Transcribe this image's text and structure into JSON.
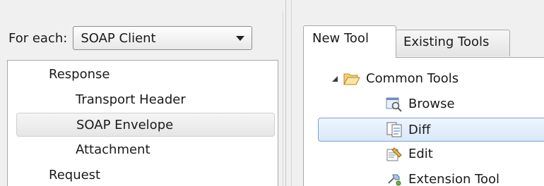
{
  "left": {
    "for_each_label": "For each:",
    "select_value": "SOAP Client",
    "tree": [
      "Response",
      "Transport Header",
      "SOAP Envelope",
      "Attachment",
      "Request"
    ]
  },
  "right": {
    "tabs": [
      "New Tool",
      "Existing Tools"
    ],
    "root_label": "Common Tools",
    "items": [
      "Browse",
      "Diff",
      "Edit",
      "Extension Tool"
    ]
  }
}
